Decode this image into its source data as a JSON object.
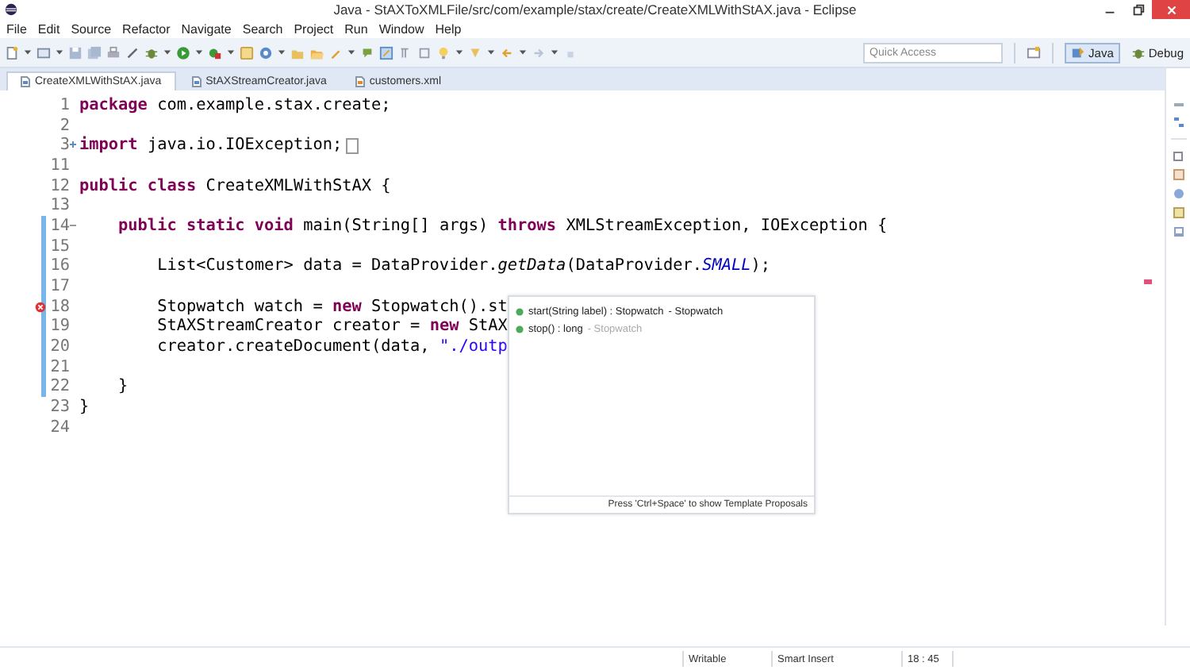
{
  "window": {
    "title": "Java - StAXToXMLFile/src/com/example/stax/create/CreateXMLWithStAX.java - Eclipse"
  },
  "menu": [
    "File",
    "Edit",
    "Source",
    "Refactor",
    "Navigate",
    "Search",
    "Project",
    "Run",
    "Window",
    "Help"
  ],
  "quick_access": {
    "placeholder": "Quick Access"
  },
  "perspectives": [
    {
      "label": "Java",
      "selected": true
    },
    {
      "label": "Debug",
      "selected": false
    }
  ],
  "tabs": [
    {
      "label": "CreateXMLWithStAX.java",
      "selected": true
    },
    {
      "label": "StAXStreamCreator.java",
      "selected": false
    },
    {
      "label": "customers.xml",
      "selected": false
    }
  ],
  "code_lines": [
    {
      "number": "1",
      "tokens": [
        {
          "kind": "keyword",
          "text": "package"
        },
        {
          "kind": "plain",
          "text": " com.example.stax.create;"
        }
      ]
    },
    {
      "number": "2"
    },
    {
      "number": "3",
      "collapsed": true,
      "tokens": [
        {
          "kind": "keyword",
          "text": "import"
        },
        {
          "kind": "plain",
          "text": " java.io.IOException;"
        }
      ]
    },
    {
      "number": "11"
    },
    {
      "number": "12",
      "tokens": [
        {
          "kind": "keyword",
          "text": "public class"
        },
        {
          "kind": "plain",
          "text": " CreateXMLWithStAX {"
        }
      ]
    },
    {
      "number": "13"
    },
    {
      "number": "14",
      "changed": true,
      "collapsed": false,
      "tokens": [
        {
          "kind": "keyword",
          "text": "    public static void"
        },
        {
          "kind": "plain",
          "text": " main(String[] args) "
        },
        {
          "kind": "keyword",
          "text": "throws"
        },
        {
          "kind": "plain",
          "text": " XMLStreamException, IOException {"
        }
      ]
    },
    {
      "number": "15",
      "changed": true
    },
    {
      "number": "16",
      "changed": true,
      "tokens": [
        {
          "kind": "plain",
          "text": "        List<Customer> data = DataProvider."
        },
        {
          "kind": "method",
          "text": "getData"
        },
        {
          "kind": "plain",
          "text": "(DataProvider."
        },
        {
          "kind": "constant",
          "text": "SMALL"
        },
        {
          "kind": "plain",
          "text": ");"
        }
      ]
    },
    {
      "number": "17",
      "changed": true
    },
    {
      "number": "18",
      "changed": true,
      "error": true,
      "tokens": [
        {
          "kind": "plain",
          "text": "        Stopwatch watch = "
        },
        {
          "kind": "keyword",
          "text": "new"
        },
        {
          "kind": "plain",
          "text": " Stopwatch().st"
        }
      ]
    },
    {
      "number": "19",
      "changed": true,
      "tokens": [
        {
          "kind": "plain",
          "text": "        StAXStreamCreator creator = "
        },
        {
          "kind": "keyword",
          "text": "new"
        },
        {
          "kind": "plain",
          "text": " StAX"
        }
      ]
    },
    {
      "number": "20",
      "changed": true,
      "tokens": [
        {
          "kind": "plain",
          "text": "        creator.createDocument(data, "
        },
        {
          "kind": "string",
          "text": "\"./outp"
        }
      ]
    },
    {
      "number": "21",
      "changed": true
    },
    {
      "number": "22",
      "changed": true,
      "tokens": [
        {
          "kind": "plain",
          "text": "    }"
        }
      ]
    },
    {
      "number": "23",
      "tokens": [
        {
          "kind": "plain",
          "text": "}"
        }
      ]
    },
    {
      "number": "24"
    }
  ],
  "proposals": {
    "items": [
      {
        "signature": "start(String label) : Stopwatch",
        "owner": "- Stopwatch",
        "selected": true
      },
      {
        "signature": "stop() : long",
        "owner": "- Stopwatch",
        "selected": false
      }
    ],
    "footer": "Press 'Ctrl+Space' to show Template Proposals"
  },
  "status_bar": [
    "Writable",
    "Smart Insert",
    "18 : 45"
  ]
}
